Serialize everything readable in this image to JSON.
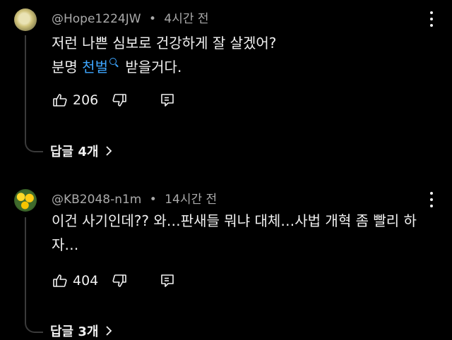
{
  "comments": [
    {
      "author": "@Hope1224JW",
      "separator": "•",
      "time": "4시간 전",
      "text_line1": "저런 나쁜 심보로 건강하게 잘 살겠어?",
      "text_line2_prefix": "분명 ",
      "text_link": "천벌",
      "text_line2_suffix": " 받을거다.",
      "likes": "206",
      "replies": "답글 4개"
    },
    {
      "author": "@KB2048-n1m",
      "separator": "•",
      "time": "14시간 전",
      "text": "이건 사기인데?? 와…판새들 뭐냐 대체…사법 개혁 좀 빨리 하자…",
      "likes": "404",
      "replies": "답글 3개"
    }
  ],
  "icons": {
    "like": "thumb-up-icon",
    "dislike": "thumb-down-icon",
    "reply": "reply-comment-icon",
    "more": "kebab-menu-icon",
    "chevron": "chevron-right-icon",
    "search": "search-icon"
  },
  "colors": {
    "background": "#000000",
    "text": "#f1f1f1",
    "meta": "#aaaaaa",
    "link": "#3ea6ff"
  }
}
